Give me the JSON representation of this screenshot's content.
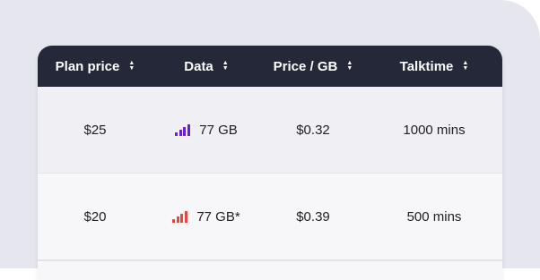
{
  "colors": {
    "header_bg": "#252838",
    "signal_purple": "#6a1fd1",
    "signal_red": "#e8453c"
  },
  "table": {
    "headers": [
      {
        "label": "Plan price",
        "sort_icon": "sort-icon"
      },
      {
        "label": "Data",
        "sort_icon": "sort-icon"
      },
      {
        "label": "Price / GB",
        "sort_icon": "sort-icon"
      },
      {
        "label": "Talktime",
        "sort_icon": "sort-icon"
      }
    ],
    "rows": [
      {
        "plan_price": "$25",
        "data": "77 GB",
        "signal_color": "purple",
        "price_per_gb": "$0.32",
        "talktime": "1000 mins"
      },
      {
        "plan_price": "$20",
        "data": "77 GB*",
        "signal_color": "red",
        "price_per_gb": "$0.39",
        "talktime": "500 mins"
      }
    ]
  }
}
